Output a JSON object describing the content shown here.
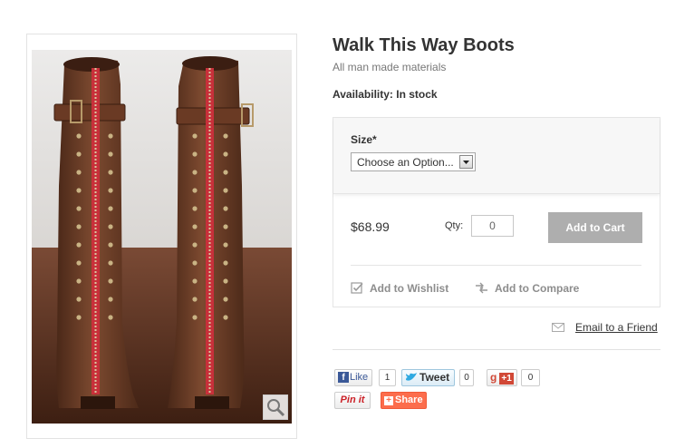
{
  "product": {
    "title": "Walk This Way Boots",
    "description": "All man made materials",
    "availability": "Availability: In stock"
  },
  "options": {
    "size_label": "Size*",
    "size_selected": "Choose an Option..."
  },
  "purchase": {
    "price": "$68.99",
    "qty_label": "Qty:",
    "qty_value": "0",
    "add_to_cart": "Add to Cart"
  },
  "links": {
    "wishlist": "Add to Wishlist",
    "compare": "Add to Compare",
    "email": "Email to a Friend"
  },
  "social": {
    "facebook_label": "Like",
    "facebook_count": "1",
    "twitter_label": "Tweet",
    "twitter_count": "0",
    "gplus_label": "+1",
    "gplus_count": "0",
    "pinterest_label": "Pin it",
    "share_label": "Share"
  },
  "colors": {
    "boot_brown": "#6b3a22",
    "zipper_red": "#c8303a",
    "button_gray": "#aeaeae"
  }
}
